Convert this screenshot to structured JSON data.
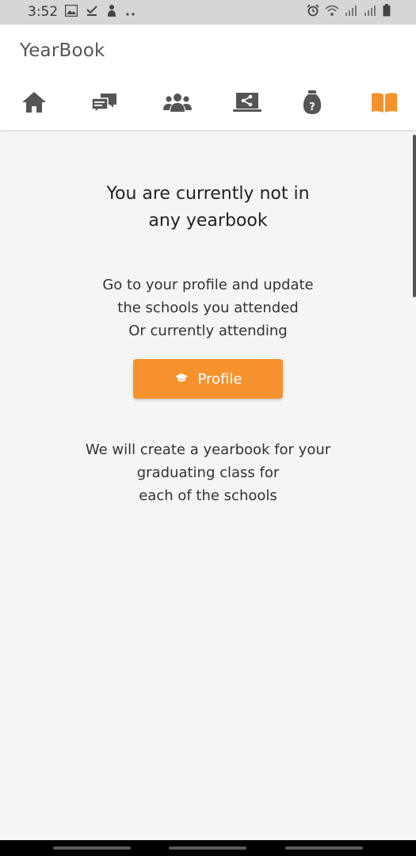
{
  "status_bar": {
    "time": "3:52",
    "left_icons": [
      "image-icon",
      "download-done-icon",
      "person-icon",
      "more-dots-icon"
    ],
    "right_icons": [
      "alarm-icon",
      "wifi-icon",
      "signal-icon",
      "signal-icon",
      "battery-icon"
    ]
  },
  "header": {
    "title": "YearBook",
    "tabs": [
      {
        "name": "home",
        "icon": "home-icon",
        "active": false
      },
      {
        "name": "chat",
        "icon": "chat-icon",
        "active": false
      },
      {
        "name": "groups",
        "icon": "people-icon",
        "active": false
      },
      {
        "name": "share",
        "icon": "share-icon",
        "active": false
      },
      {
        "name": "question-bag",
        "icon": "question-bag-icon",
        "active": false
      },
      {
        "name": "yearbook",
        "icon": "book-icon",
        "active": true
      }
    ]
  },
  "main": {
    "headline_line1": "You are currently not in",
    "headline_line2": "any yearbook",
    "instruction_line1": "Go to your profile and update",
    "instruction_line2": "the schools you attended",
    "instruction_line3": "Or currently attending",
    "profile_button_label": "Profile",
    "footer_line1": "We will create a yearbook for your",
    "footer_line2": "graduating class for",
    "footer_line3": "each of the schools"
  },
  "colors": {
    "accent": "#f6922e",
    "icon_gray": "#555555",
    "background": "#f5f5f5"
  }
}
